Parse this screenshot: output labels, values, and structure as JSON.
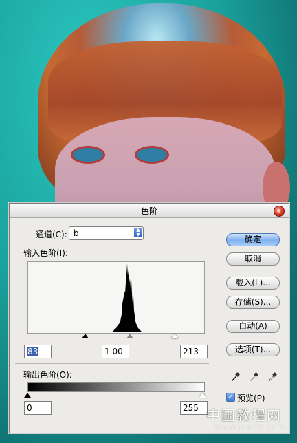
{
  "dialog": {
    "title": "色阶",
    "channel_label": "通道(C):",
    "channel_value": "b",
    "input_levels_label": "输入色阶(I):",
    "output_levels_label": "输出色阶(O):",
    "input": {
      "black": "83",
      "gamma": "1.00",
      "white": "213"
    },
    "output": {
      "black": "0",
      "white": "255"
    },
    "buttons": {
      "ok": "确定",
      "cancel": "取消",
      "load": "载入(L)...",
      "save": "存储(S)...",
      "auto": "自动(A)",
      "options": "选项(T)..."
    },
    "preview_label": "预览(P)",
    "preview_checked": true,
    "eyedroppers": [
      "black-eyedropper-icon",
      "gray-eyedropper-icon",
      "white-eyedropper-icon"
    ]
  },
  "watermark": {
    "line1": "中国教程网",
    "line2": "www.jcwcn.com"
  }
}
